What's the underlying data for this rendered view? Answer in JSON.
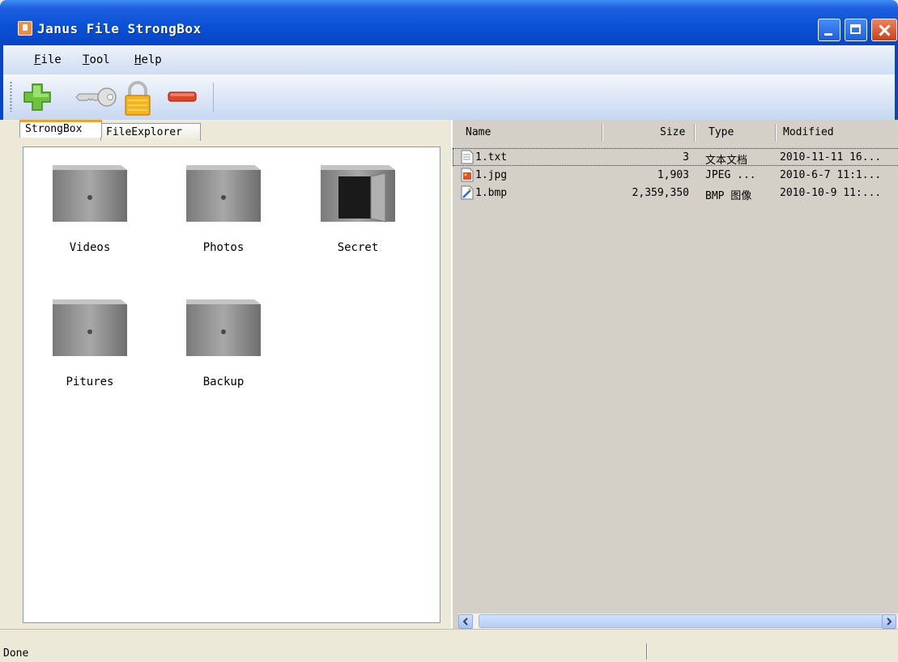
{
  "window": {
    "title": "Janus File StrongBox"
  },
  "menu": [
    {
      "label": "File",
      "mnemonic": "F",
      "rest": "ile"
    },
    {
      "label": "Tool",
      "mnemonic": "T",
      "rest": "ool"
    },
    {
      "label": "Help",
      "mnemonic": "H",
      "rest": "elp"
    }
  ],
  "toolbar": {
    "buttons": [
      {
        "icon": "plus-icon",
        "color": "#6cc43a"
      },
      {
        "icon": "key-icon",
        "color": "#c8c8c8"
      },
      {
        "icon": "lock-icon",
        "color": "#f2b020"
      },
      {
        "icon": "minus-icon",
        "color": "#e0442a"
      }
    ]
  },
  "left_tabs": [
    {
      "label": "StrongBox",
      "active": true
    },
    {
      "label": "FileExplorer",
      "active": false
    }
  ],
  "strongboxes": [
    {
      "label": "Videos",
      "open": false
    },
    {
      "label": "Photos",
      "open": false
    },
    {
      "label": "Secret",
      "open": true
    },
    {
      "label": "Pitures",
      "open": false
    },
    {
      "label": "Backup",
      "open": false
    }
  ],
  "file_list": {
    "columns": [
      "Name",
      "Size",
      "Type",
      "Modified"
    ],
    "rows": [
      {
        "name": "1.txt",
        "size": "3",
        "type": "文本文档",
        "modified": "2010-11-11 16...",
        "icon": "text-file-icon",
        "selected": true
      },
      {
        "name": "1.jpg",
        "size": "1,903",
        "type": "JPEG ...",
        "modified": "2010-6-7 11:1...",
        "icon": "jpeg-file-icon",
        "selected": false
      },
      {
        "name": "1.bmp",
        "size": "2,359,350",
        "type": "BMP 图像",
        "modified": "2010-10-9 11:...",
        "icon": "bmp-file-icon",
        "selected": false
      }
    ]
  },
  "status": {
    "text": "Done"
  },
  "colors": {
    "title_bar": "#0a52d6",
    "close_button": "#e05a2a",
    "tab_accent": "#f0a030"
  }
}
